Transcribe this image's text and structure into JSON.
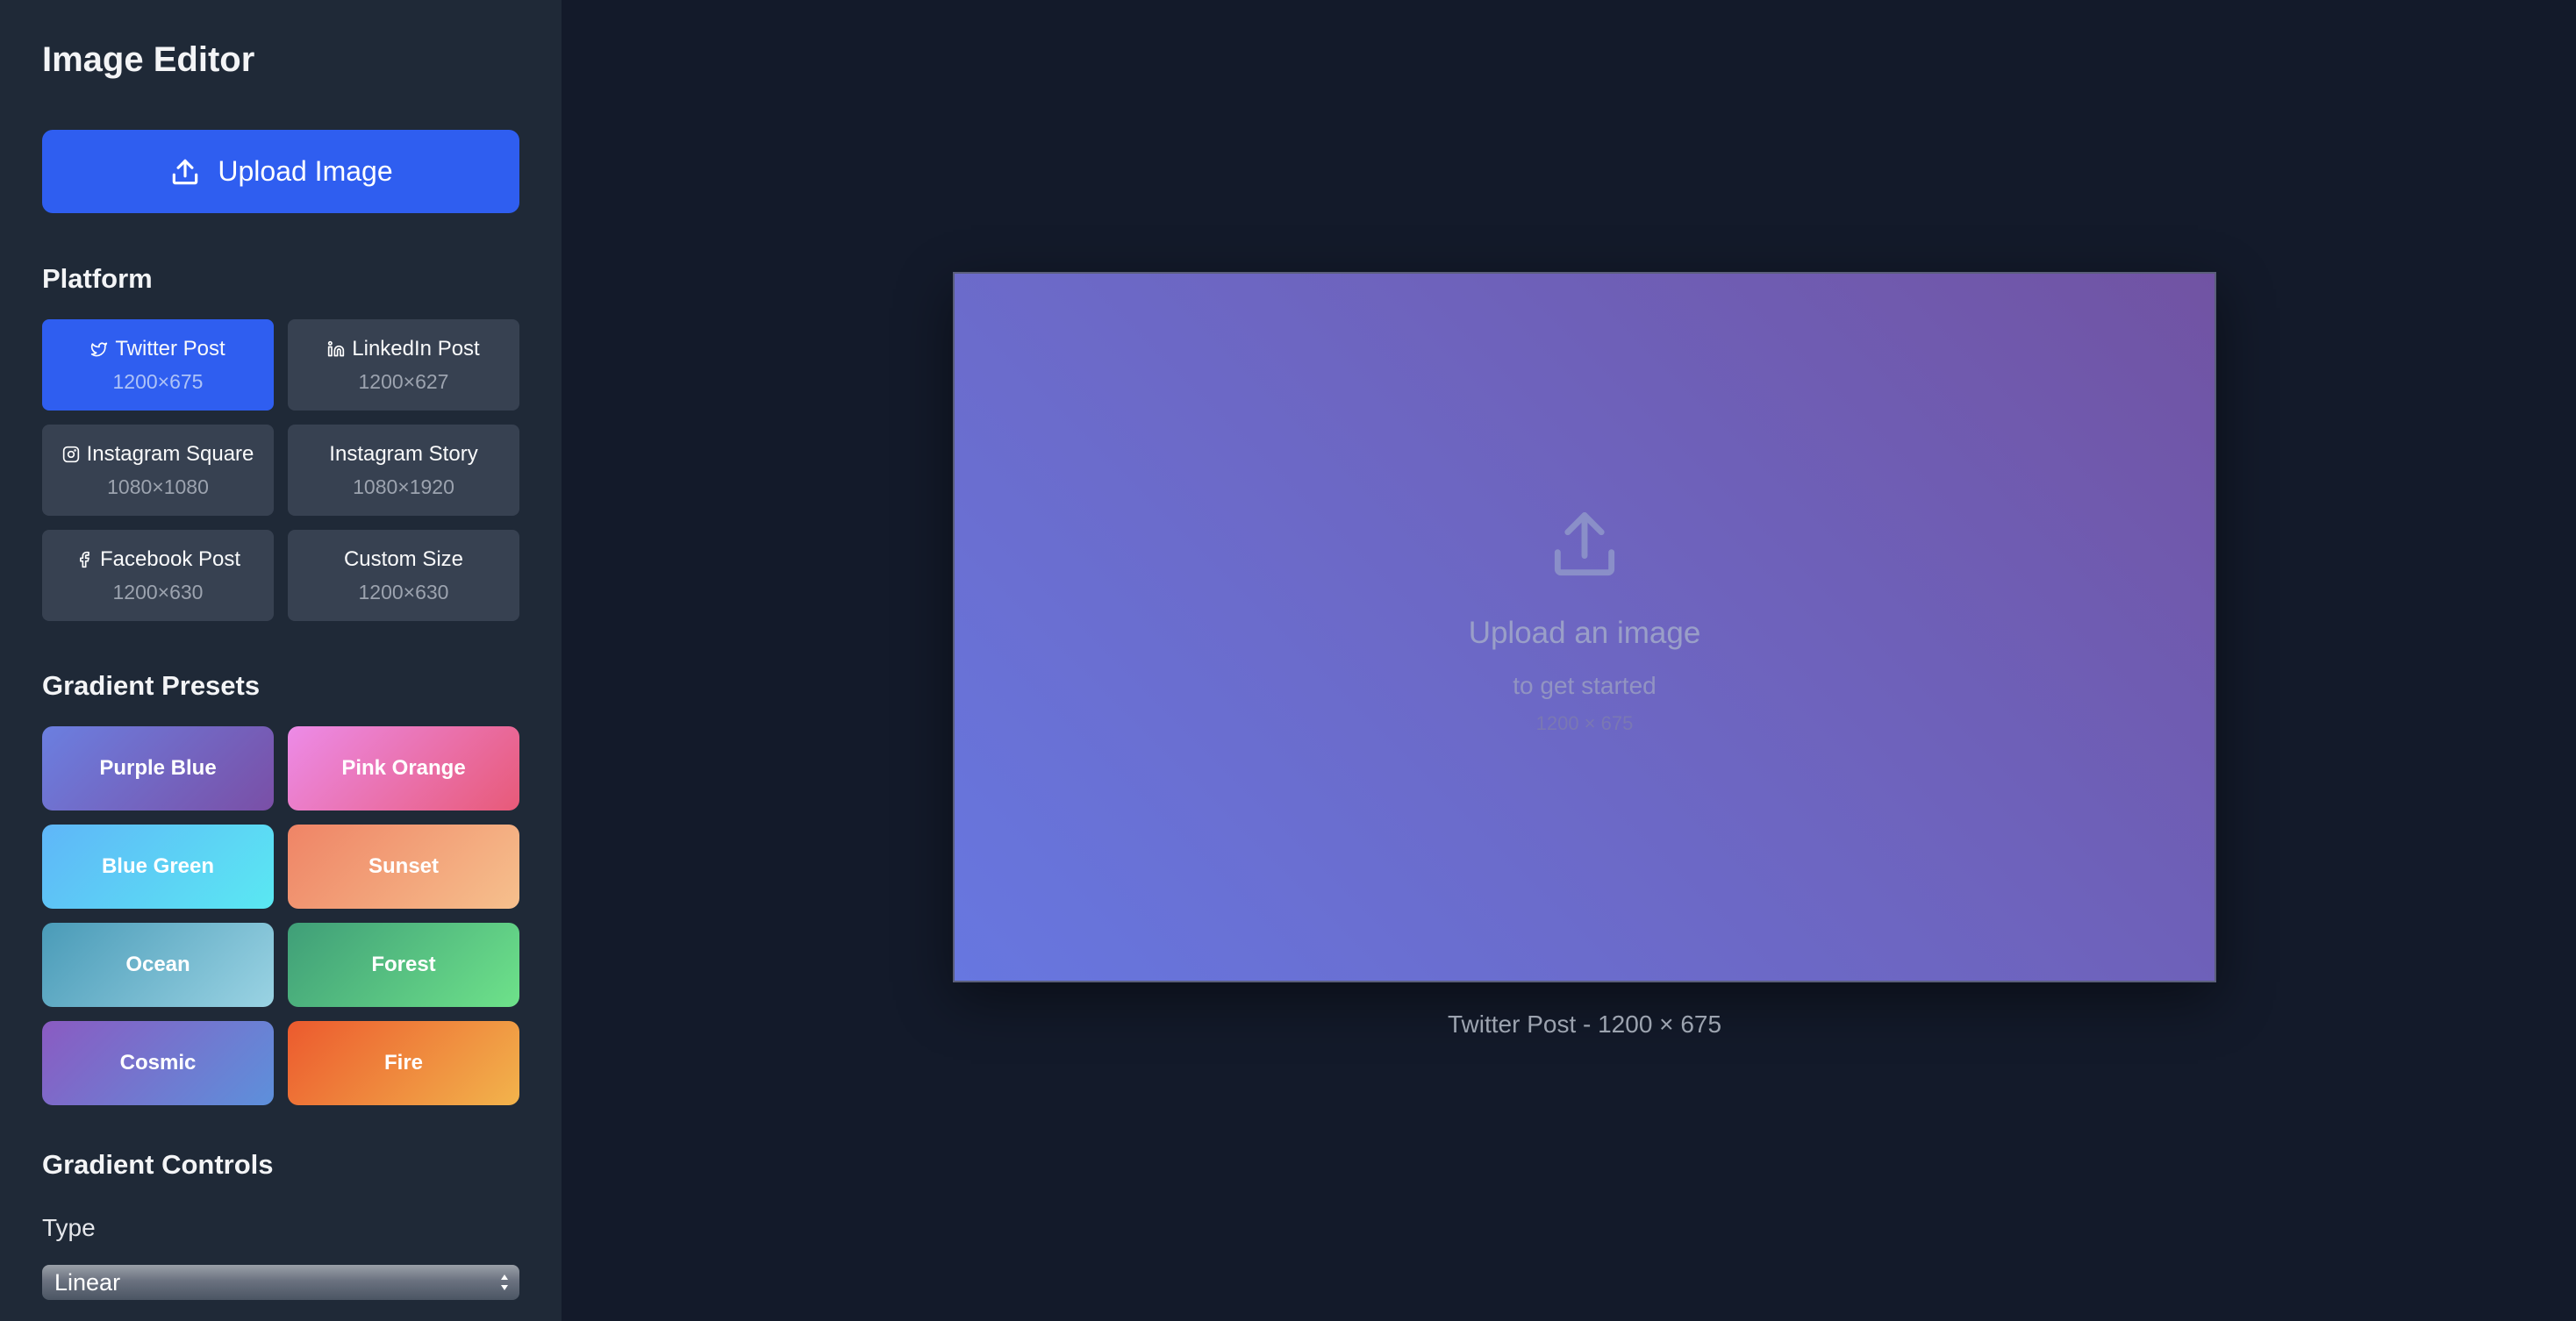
{
  "app": {
    "title": "Image Editor"
  },
  "upload": {
    "label": "Upload Image",
    "icon": "upload-icon"
  },
  "platform": {
    "title": "Platform",
    "items": [
      {
        "name": "Twitter Post",
        "size": "1200×675",
        "icon": "twitter-icon",
        "active": true
      },
      {
        "name": "LinkedIn Post",
        "size": "1200×627",
        "icon": "linkedin-icon",
        "active": false
      },
      {
        "name": "Instagram Square",
        "size": "1080×1080",
        "icon": "instagram-icon",
        "active": false
      },
      {
        "name": "Instagram Story",
        "size": "1080×1920",
        "icon": "",
        "active": false
      },
      {
        "name": "Facebook Post",
        "size": "1200×630",
        "icon": "facebook-icon",
        "active": false
      },
      {
        "name": "Custom Size",
        "size": "1200×630",
        "icon": "",
        "active": false
      }
    ]
  },
  "gradients": {
    "title": "Gradient Presets",
    "items": [
      {
        "name": "Purple Blue",
        "from": "#6b7fe0",
        "to": "#7a4fa6"
      },
      {
        "name": "Pink Orange",
        "from": "#ec8be8",
        "to": "#e85a78"
      },
      {
        "name": "Blue Green",
        "from": "#5fb6f8",
        "to": "#5ae8f2"
      },
      {
        "name": "Sunset",
        "from": "#ef8466",
        "to": "#f6c08d"
      },
      {
        "name": "Ocean",
        "from": "#4a9bb8",
        "to": "#9ad3e3"
      },
      {
        "name": "Forest",
        "from": "#3f9e78",
        "to": "#6ee28a"
      },
      {
        "name": "Cosmic",
        "from": "#8a5bc2",
        "to": "#5d90db"
      },
      {
        "name": "Fire",
        "from": "#ec5a2e",
        "to": "#f2b44c"
      }
    ]
  },
  "controls": {
    "title": "Gradient Controls",
    "type_label": "Type",
    "type_value": "Linear"
  },
  "canvas": {
    "title": "Upload an image",
    "subtitle": "to get started",
    "dims": "1200 × 675",
    "caption": "Twitter Post - 1200 × 675"
  },
  "colors": {
    "accent": "#2f5ef0",
    "sidebar_bg": "#1f2937",
    "card_bg": "#374151",
    "main_bg": "#131a2a"
  }
}
